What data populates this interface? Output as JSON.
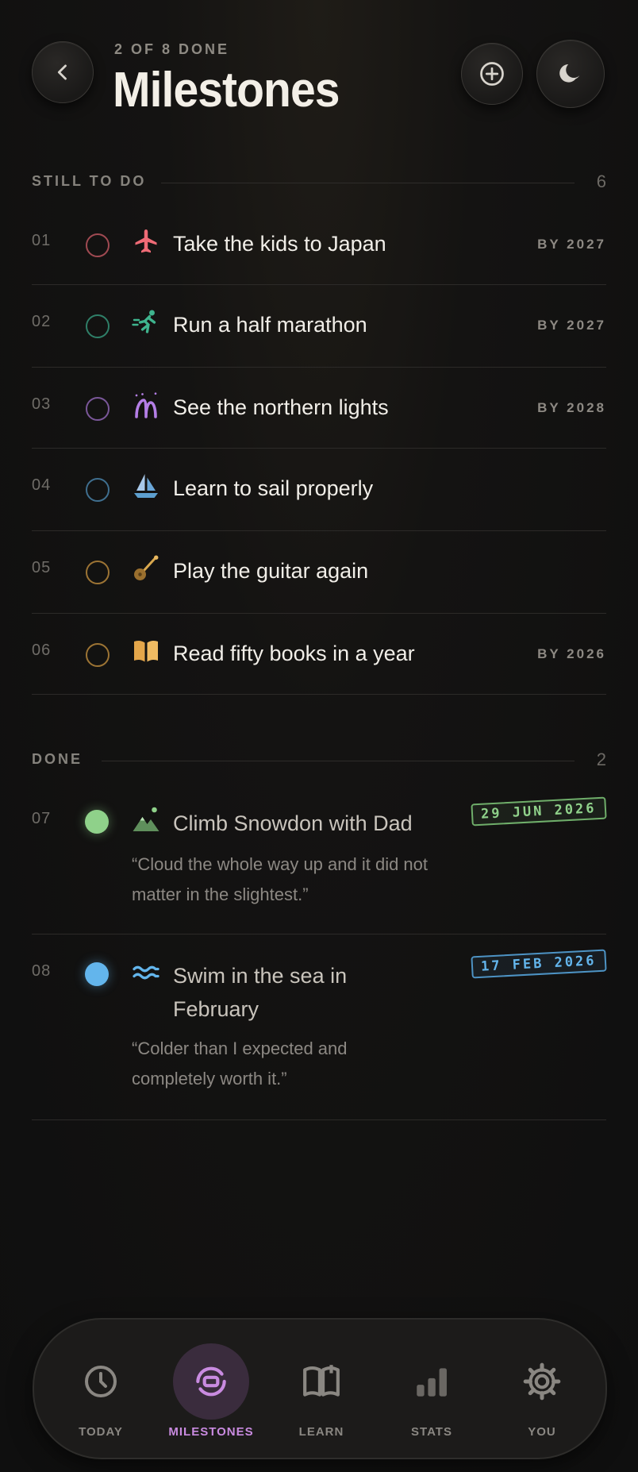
{
  "header": {
    "progress_text": "2 OF 8 DONE",
    "title": "Milestones"
  },
  "todo": {
    "label": "STILL TO DO",
    "count": "6",
    "items": [
      {
        "num": "01",
        "title": "Take the kids to Japan",
        "by": "BY 2027",
        "color": "#e0626d",
        "icon": "airplane-icon"
      },
      {
        "num": "02",
        "title": "Run a half marathon",
        "by": "BY 2027",
        "color": "#3fb48e",
        "icon": "runner-icon"
      },
      {
        "num": "03",
        "title": "See the northern lights",
        "by": "BY 2028",
        "color": "#a877d8",
        "icon": "aurora-icon"
      },
      {
        "num": "04",
        "title": "Learn to sail properly",
        "by": "",
        "color": "#5d9fcf",
        "icon": "sailboat-icon"
      },
      {
        "num": "05",
        "title": "Play the guitar again",
        "by": "",
        "color": "#d2a24b",
        "icon": "guitar-icon"
      },
      {
        "num": "06",
        "title": "Read fifty books in a year",
        "by": "BY 2026",
        "color": "#e4a64a",
        "icon": "book-icon"
      }
    ]
  },
  "done": {
    "label": "DONE",
    "count": "2",
    "items": [
      {
        "num": "07",
        "title": "Climb Snowdon with Dad",
        "quote": "“Cloud the whole way up and it did not matter in the slightest.”",
        "date": "29 JUN 2026",
        "color": "#8fd18a",
        "icon": "mountain-icon"
      },
      {
        "num": "08",
        "title": "Swim in the sea in February",
        "quote": "“Colder than I expected and completely worth it.”",
        "date": "17 FEB 2026",
        "color": "#63b5ec",
        "icon": "waves-icon"
      }
    ]
  },
  "nav": {
    "items": [
      {
        "label": "TODAY",
        "icon": "clock-icon"
      },
      {
        "label": "MILESTONES",
        "icon": "milestones-icon",
        "active": true
      },
      {
        "label": "LEARN",
        "icon": "book-open-icon"
      },
      {
        "label": "STATS",
        "icon": "bar-chart-icon"
      },
      {
        "label": "YOU",
        "icon": "gear-icon"
      }
    ]
  }
}
